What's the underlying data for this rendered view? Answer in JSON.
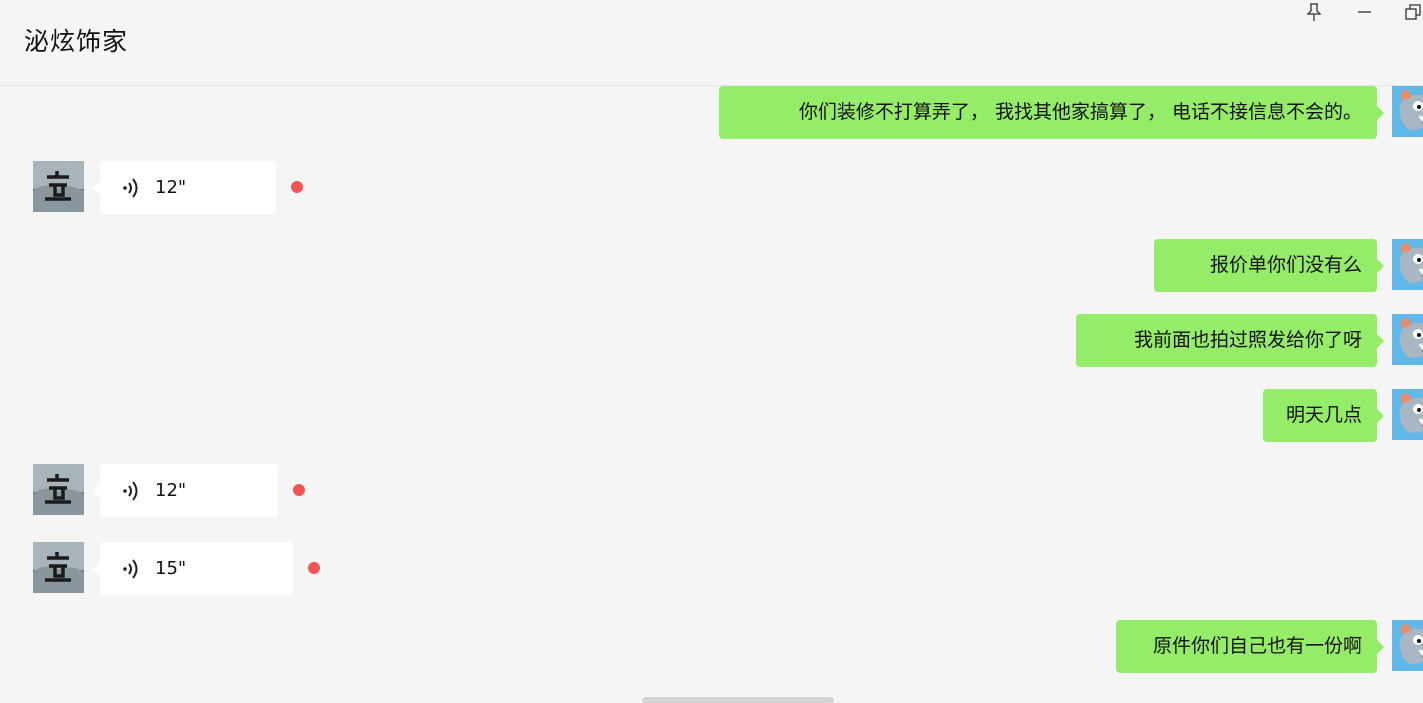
{
  "window": {
    "title": "泌炫饰家",
    "controls": [
      "pin-icon",
      "minimize-icon",
      "restore-icon"
    ]
  },
  "colors": {
    "sent_bubble": "#95ec69",
    "received_bubble": "#ffffff",
    "unread_dot": "#f05454",
    "background": "#f5f5f5"
  },
  "messages": [
    {
      "direction": "sent",
      "type": "text",
      "text": "你们装修不打算弄了， 我找其他家搞算了，  电话不接信息不会的。"
    },
    {
      "direction": "received",
      "type": "voice",
      "duration": "12\"",
      "unread": true
    },
    {
      "direction": "sent",
      "type": "text",
      "text": "报价单你们没有么"
    },
    {
      "direction": "sent",
      "type": "text",
      "text": "我前面也拍过照发给你了呀"
    },
    {
      "direction": "sent",
      "type": "text",
      "text": "明天几点"
    },
    {
      "direction": "received",
      "type": "voice",
      "duration": "12\"",
      "unread": true
    },
    {
      "direction": "received",
      "type": "voice",
      "duration": "15\"",
      "unread": true
    },
    {
      "direction": "sent",
      "type": "text",
      "text": "原件你们自己也有一份啊"
    }
  ]
}
